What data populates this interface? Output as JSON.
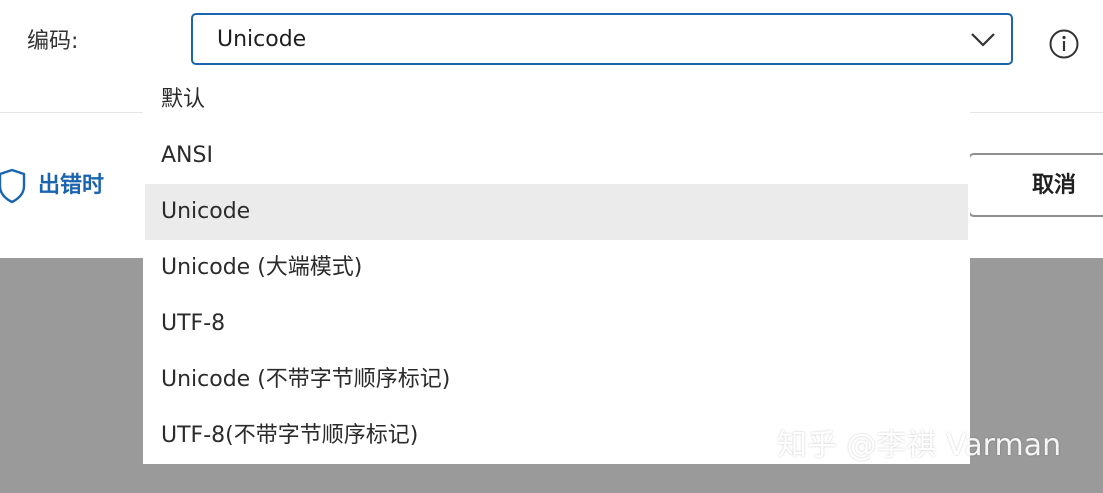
{
  "encoding": {
    "label": "编码:",
    "selected_value": "Unicode"
  },
  "error_link": {
    "label": "出错时"
  },
  "cancel_button": {
    "label": "取消"
  },
  "dropdown": {
    "options": [
      "默认",
      "ANSI",
      "Unicode",
      "Unicode (大端模式)",
      "UTF-8",
      "Unicode (不带字节顺序标记)",
      "UTF-8(不带字节顺序标记)"
    ],
    "selected_index": 2
  },
  "watermark": {
    "text": "知乎 @李祺 Varman"
  },
  "icons": {
    "dropdown": "chevron-down-icon",
    "info": "info-icon",
    "shield": "shield-icon"
  },
  "colors": {
    "accent": "#1a64b0",
    "overlay": "#9a9a9a",
    "selected_item_bg": "#ebebeb"
  }
}
